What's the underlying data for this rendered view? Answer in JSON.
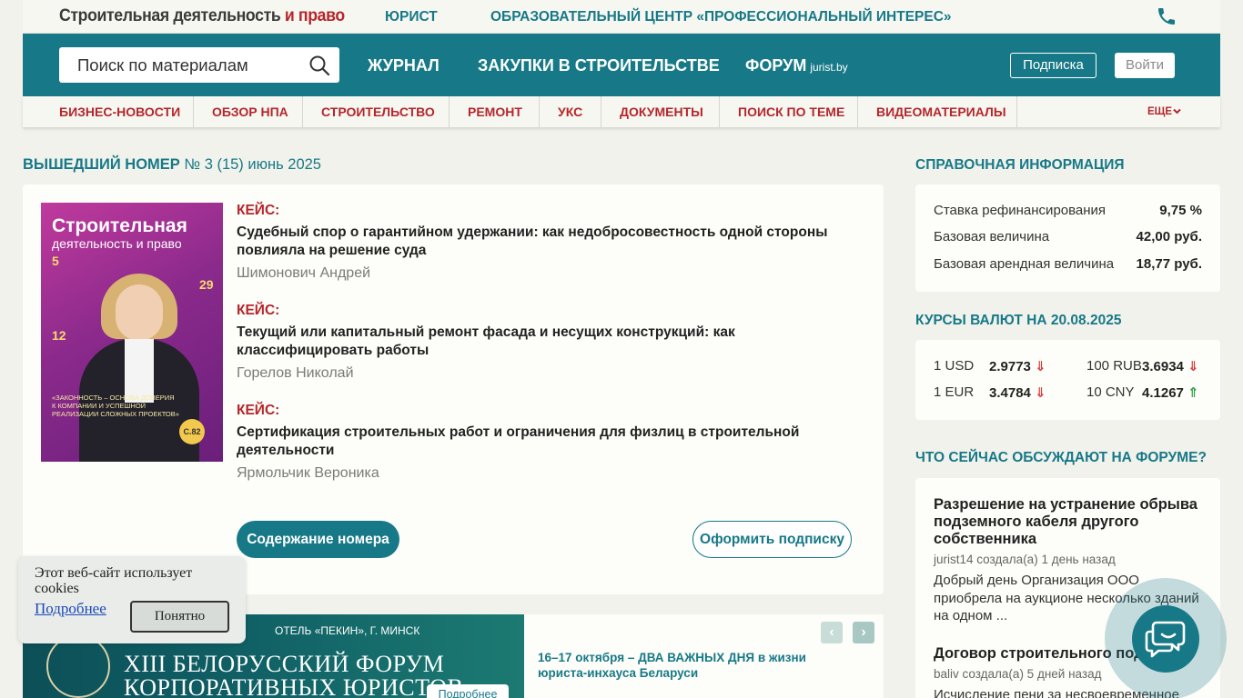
{
  "topbar": {
    "logo_main": "Строительная деятельность",
    "logo_accent": "и право",
    "links": [
      "ЮРИСТ",
      "ОБРАЗОВАТЕЛЬНЫЙ ЦЕНТР «ПРОФЕССИОНАЛЬНЫЙ ИНТЕРЕС»"
    ]
  },
  "mainnav": {
    "search_placeholder": "Поиск по материалам",
    "items": [
      "ЖУРНАЛ",
      "ЗАКУПКИ В СТРОИТЕЛЬСТВЕ",
      "ФОРУМ"
    ],
    "forum_suffix": "jurist.by",
    "subscribe_label": "Подписка",
    "login_label": "Войти"
  },
  "subnav": {
    "items": [
      "БИЗНЕС-НОВОСТИ",
      "ОБЗОР НПА",
      "СТРОИТЕЛЬСТВО",
      "РЕМОНТ",
      "УКС",
      "ДОКУМЕНТЫ",
      "ПОИСК ПО ТЕМЕ",
      "ВИДЕОМАТЕРИАЛЫ"
    ],
    "more_label": "ЕЩЕ"
  },
  "issue": {
    "heading_bold": "ВЫШЕДШИЙ НОМЕР",
    "heading_rest": "№ 3 (15) июнь 2025",
    "cover": {
      "title1": "Строительная",
      "title2": "деятельность и право",
      "nums": [
        "5",
        "29",
        "12"
      ],
      "quote": "«ЗАКОННОСТЬ – ОСНОВА ДОВЕРИЯ К КОМПАНИИ И УСПЕШНОЙ РЕАЛИЗАЦИИ СЛОЖНЫХ ПРОЕКТОВ»",
      "badge": "С.82"
    },
    "articles": [
      {
        "kind": "КЕЙС:",
        "title": "Судебный спор о гарантийном удержании: как недобросовестность одной стороны повлияла на решение суда",
        "author": "Шимонович Андрей"
      },
      {
        "kind": "КЕЙС:",
        "title": "Текущий или капитальный ремонт фасада и несущих конструкций: как классифицировать работы",
        "author": "Горелов Николай"
      },
      {
        "kind": "КЕЙС:",
        "title": "Сертификация строительных работ и ограничения для физлиц в строительной деятельности",
        "author": "Ярмольчик Вероника"
      }
    ],
    "contents_label": "Содержание номера",
    "subscribe_label": "Оформить подписку"
  },
  "banner": {
    "hotel": "ОТЕЛЬ «ПЕКИН», Г. МИНСК",
    "forum_line1": "XIII БЕЛОРУССКИЙ ФОРУМ",
    "forum_line2": "КОРПОРАТИВНЫХ ЮРИСТОВ",
    "more_label": "Подробнее",
    "text": "16–17 октября – ДВА ВАЖНЫХ ДНЯ в жизни юриста-инхауса Беларуси",
    "prev": "‹",
    "next": "›"
  },
  "reference": {
    "heading": "СПРАВОЧНАЯ ИНФОРМАЦИЯ",
    "rows": [
      {
        "label": "Ставка рефинансирования",
        "value": "9,75 %"
      },
      {
        "label": "Базовая величина",
        "value": "42,00 руб."
      },
      {
        "label": "Базовая арендная величина",
        "value": "18,77 руб."
      }
    ]
  },
  "rates": {
    "heading": "КУРСЫ ВАЛЮТ НА 20.08.2025",
    "items": [
      {
        "currency": "1 USD",
        "value": "2.9773",
        "trend": "⇓"
      },
      {
        "currency": "100 RUB",
        "value": "3.6934",
        "trend": "⇓"
      },
      {
        "currency": "1 EUR",
        "value": "3.4784",
        "trend": "⇓"
      },
      {
        "currency": "10 CNY",
        "value": "4.1267",
        "trend": "⇑"
      }
    ]
  },
  "forum": {
    "heading": "ЧТО СЕЙЧАС ОБСУЖДАЮТ НА ФОРУМЕ?",
    "items": [
      {
        "title": "Разрешение на устранение обрыва подземного кабеля другого собственника",
        "meta": "jurist14 создала(а) 1 день назад",
        "text": "Добрый день Организация ООО приобрела на аукционе несколько зданий на одном ..."
      },
      {
        "title": "Договор строительного подряда",
        "meta": "baliv создала(а) 5 дней назад",
        "text": "Исчисление пени за несвоевременное"
      }
    ]
  },
  "cookie": {
    "text": "Этот веб-сайт использует cookies",
    "link": "Подробнее",
    "button": "Понятно"
  },
  "colors": {
    "teal": "#177987",
    "red": "#b5262b"
  }
}
